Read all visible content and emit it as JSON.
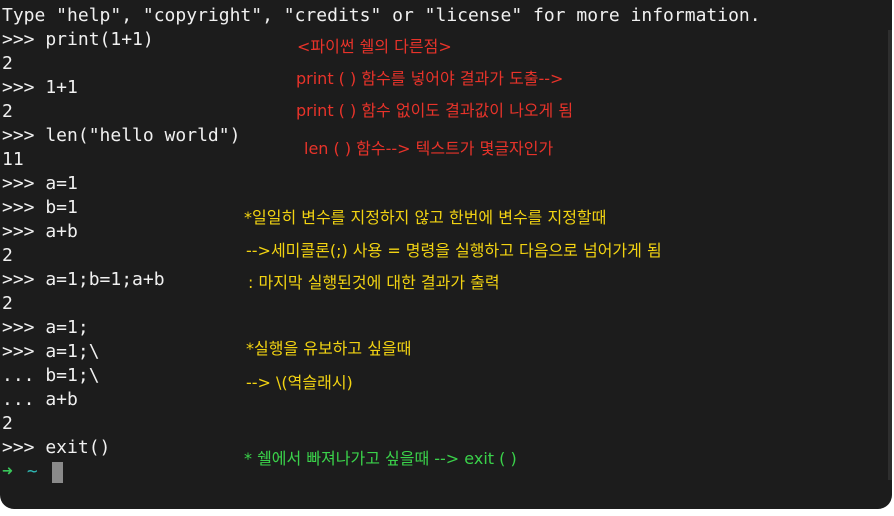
{
  "terminal": {
    "lines": [
      "Type \"help\", \"copyright\", \"credits\" or \"license\" for more information.",
      ">>> print(1+1)",
      "2",
      ">>> 1+1",
      "2",
      ">>> len(\"hello world\")",
      "11",
      ">>> a=1",
      ">>> b=1",
      ">>> a+b",
      "2",
      ">>> a=1;b=1;a+b",
      "2",
      ">>> a=1;",
      ">>> a=1;\\",
      "... b=1;\\",
      "... a+b",
      "2",
      ">>> exit()"
    ],
    "shell_prompt": {
      "arrow": "➜",
      "dir": "~"
    }
  },
  "notes": {
    "shell_difference": "<파이썬 쉘의 다른점>",
    "print_note": "print ( ) 함수를 넣어야 결과가 도출-->",
    "no_print_note": "print ( ) 함수 없이도 결과값이 나오게 됨",
    "len_note": "len ( ) 함수--> 텍스트가 몇글자인가",
    "semicolon_1": "*일일히 변수를 지정하지 않고 한번에 변수를 지정할때",
    "semicolon_2": "-->세미콜론(;) 사용 = 명령을 실행하고 다음으로 넘어가게 됨",
    "semicolon_3": ": 마지막 실행된것에 대한 결과가 출력",
    "backslash_1": "*실행을 유보하고 싶을때",
    "backslash_2": "--> \\(역슬래시)",
    "exit_note": "* 쉘에서 빠져나가고 싶을때 --> exit ( )"
  },
  "colors": {
    "background": "#1c1c1c",
    "text": "#f0f0f0",
    "red_note": "#e8332a",
    "yellow_note": "#f2d312",
    "green_note": "#3ad24a"
  }
}
